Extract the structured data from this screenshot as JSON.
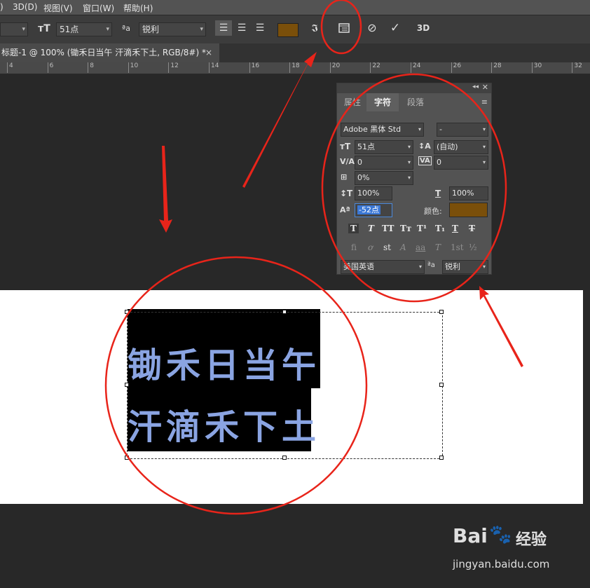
{
  "menubar": {
    "items": [
      ")",
      "3D(D)",
      "视图(V)",
      "窗口(W)",
      "帮助(H)"
    ]
  },
  "options": {
    "font_size": "51点",
    "aa_label": "ªa",
    "antialias": "锐利",
    "color": "#7a4f0a",
    "three_d": "3D"
  },
  "tab": {
    "title": "标题-1 @ 100% (锄禾日当午 汗滴禾下土, RGB/8#) *",
    "close": "×"
  },
  "ruler": {
    "ticks": [
      "4",
      "6",
      "8",
      "10",
      "12",
      "14",
      "16",
      "18",
      "20",
      "22",
      "24",
      "26",
      "28",
      "30",
      "32"
    ]
  },
  "canvas_text": {
    "line1": "锄禾日当午",
    "line2": "汗滴禾下土",
    "text_color": "#8aa4e2"
  },
  "panel": {
    "tabs": [
      "属性",
      "字符",
      "段落"
    ],
    "active_tab": "字符",
    "font_family": "Adobe 黑体 Std",
    "font_style": "-",
    "font_size": "51点",
    "leading": "(自动)",
    "kerning": "0",
    "tracking": "0",
    "tsume": "0%",
    "vertical_scale": "100%",
    "horizontal_scale": "100%",
    "baseline_shift": "-52点",
    "color_label": "颜色:",
    "color": "#7a4f0a",
    "language": "美国英语",
    "aa_label": "ªa",
    "antialias": "锐利",
    "style_buttons": [
      "T",
      "T",
      "TT",
      "Tт",
      "T¹",
      "T₁",
      "T",
      "T"
    ],
    "opentype_buttons": [
      "ﬁ",
      "ơ",
      "st",
      "A",
      "aa",
      "T",
      "1st",
      "½"
    ]
  },
  "watermark": {
    "brand": "Bai",
    "brand_tail": "经验",
    "url": "jingyan.baidu.com"
  },
  "annotation_color": "#e8241a"
}
